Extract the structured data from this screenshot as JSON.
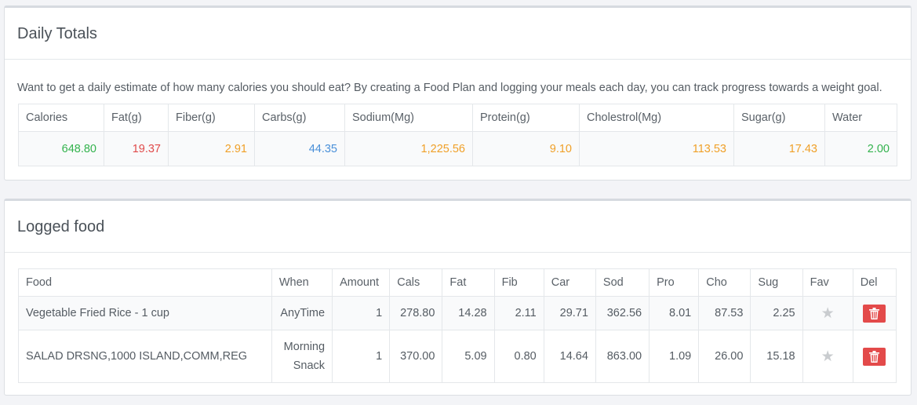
{
  "daily_totals": {
    "title": "Daily Totals",
    "description": "Want to get a daily estimate of how many calories you should eat? By creating a Food Plan and logging your meals each day, you can track progress towards a weight goal.",
    "headers": [
      "Calories",
      "Fat(g)",
      "Fiber(g)",
      "Carbs(g)",
      "Sodium(Mg)",
      "Protein(g)",
      "Cholestrol(Mg)",
      "Sugar(g)",
      "Water"
    ],
    "values": [
      "648.80",
      "19.37",
      "2.91",
      "44.35",
      "1,225.56",
      "9.10",
      "113.53",
      "17.43",
      "2.00"
    ],
    "value_colors": [
      "#33b34d",
      "#e04a4a",
      "#f0a028",
      "#4a90d9",
      "#f0a028",
      "#f0a028",
      "#f0a028",
      "#f0a028",
      "#33b34d"
    ]
  },
  "logged_food": {
    "title": "Logged food",
    "headers": [
      "Food",
      "When",
      "Amount",
      "Cals",
      "Fat",
      "Fib",
      "Car",
      "Sod",
      "Pro",
      "Cho",
      "Sug",
      "Fav",
      "Del"
    ],
    "rows": [
      {
        "food": "Vegetable Fried Rice - 1 cup",
        "when": "AnyTime",
        "amount": "1",
        "cals": "278.80",
        "fat": "14.28",
        "fib": "2.11",
        "car": "29.71",
        "sod": "362.56",
        "pro": "8.01",
        "cho": "87.53",
        "sug": "2.25",
        "fav_icon": "star-icon",
        "del_icon": "trash-icon"
      },
      {
        "food": "SALAD DRSNG,1000 ISLAND,COMM,REG",
        "when": "Morning Snack",
        "amount": "1",
        "cals": "370.00",
        "fat": "5.09",
        "fib": "0.80",
        "car": "14.64",
        "sod": "863.00",
        "pro": "1.09",
        "cho": "26.00",
        "sug": "15.18",
        "fav_icon": "star-icon",
        "del_icon": "trash-icon"
      }
    ]
  },
  "colors": {
    "delete_button": "#e34a4a",
    "favorite_star": "#c9cccf"
  }
}
